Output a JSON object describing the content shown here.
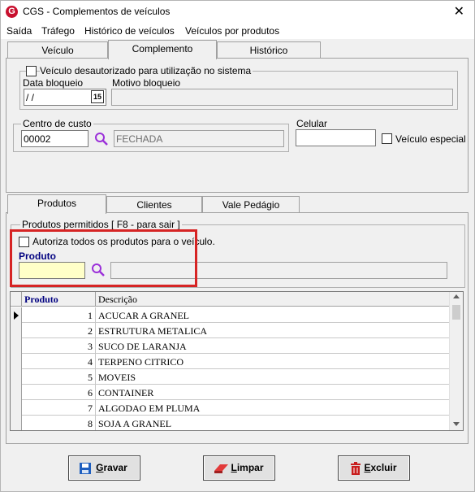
{
  "window": {
    "title": "CGS - Complementos de veículos"
  },
  "menu": [
    "Saída",
    "Tráfego",
    "Histórico de veículos",
    "Veículos por produtos"
  ],
  "main_tabs": [
    "Veículo",
    "Complemento",
    "Histórico"
  ],
  "bloqueio": {
    "checkbox_label": "Veículo desautorizado para utilização no sistema",
    "data_label": "Data bloqueio",
    "data_value": " /  /",
    "calendar_label": "15",
    "motivo_label": "Motivo bloqueio",
    "motivo_value": ""
  },
  "centro_custo": {
    "label": "Centro de custo",
    "code": "00002",
    "description": "FECHADA"
  },
  "celular": {
    "label": "Celular",
    "value": ""
  },
  "veiculo_especial": {
    "label": "Veículo especial"
  },
  "sub_tabs": [
    "Produtos",
    "Clientes",
    "Vale Pedágio"
  ],
  "produtos": {
    "group_label": "Produtos permitidos [ F8 - para sair ]",
    "autoriza_label": "Autoriza todos os produtos para o veículo.",
    "produto_label": "Produto",
    "produto_value": "",
    "produto_desc": ""
  },
  "grid": {
    "columns": [
      "Produto",
      "Descrição"
    ],
    "rows": [
      {
        "produto": "1",
        "descricao": "ACUCAR A GRANEL"
      },
      {
        "produto": "2",
        "descricao": "ESTRUTURA METALICA"
      },
      {
        "produto": "3",
        "descricao": "SUCO DE LARANJA"
      },
      {
        "produto": "4",
        "descricao": "TERPENO CITRICO"
      },
      {
        "produto": "5",
        "descricao": "MOVEIS"
      },
      {
        "produto": "6",
        "descricao": "CONTAINER"
      },
      {
        "produto": "7",
        "descricao": "ALGODAO EM PLUMA"
      },
      {
        "produto": "8",
        "descricao": "SOJA A GRANEL"
      }
    ]
  },
  "buttons": {
    "gravar": {
      "accel": "G",
      "rest": "ravar"
    },
    "limpar": {
      "accel": "L",
      "rest": "impar"
    },
    "excluir": {
      "accel": "E",
      "rest": "xcluir"
    }
  },
  "colors": {
    "highlight": "#d62424",
    "produto_label": "#000080",
    "accent_icon": "#9b30d9"
  }
}
